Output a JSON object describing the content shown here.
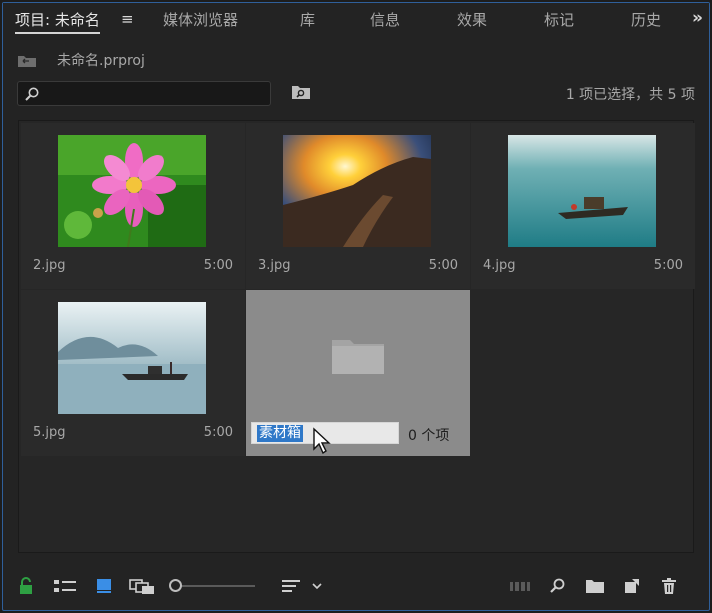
{
  "tabs": [
    {
      "label": "项目: 未命名",
      "active": true
    },
    {
      "label": "媒体浏览器"
    },
    {
      "label": "库"
    },
    {
      "label": "信息"
    },
    {
      "label": "效果"
    },
    {
      "label": "标记"
    },
    {
      "label": "历史"
    }
  ],
  "tab_menu_glyph": "≡",
  "overflow_glyph": "»",
  "project": {
    "path": "未命名.prproj"
  },
  "search": {
    "value": "",
    "placeholder": ""
  },
  "selection_status": "1 项已选择，共 5 项",
  "items": [
    {
      "name": "2.jpg",
      "duration": "5:00"
    },
    {
      "name": "3.jpg",
      "duration": "5:00"
    },
    {
      "name": "4.jpg",
      "duration": "5:00"
    },
    {
      "name": "5.jpg",
      "duration": "5:00"
    }
  ],
  "bin": {
    "name": "素材箱",
    "count": "0 个项"
  },
  "icons": [
    "bin-icon",
    "search-icon",
    "find-icon",
    "folder-icon",
    "lock-icon",
    "list-view-icon",
    "icon-view-icon",
    "freeform-view-icon",
    "sort-icon",
    "automate-icon",
    "find-button-icon",
    "new-bin-icon",
    "new-item-icon",
    "trash-icon"
  ],
  "colors": {
    "accent": "#2f78c8",
    "panel": "#232323",
    "selection_tile": "#8b8b8b",
    "lock_green": "#2ea043"
  }
}
